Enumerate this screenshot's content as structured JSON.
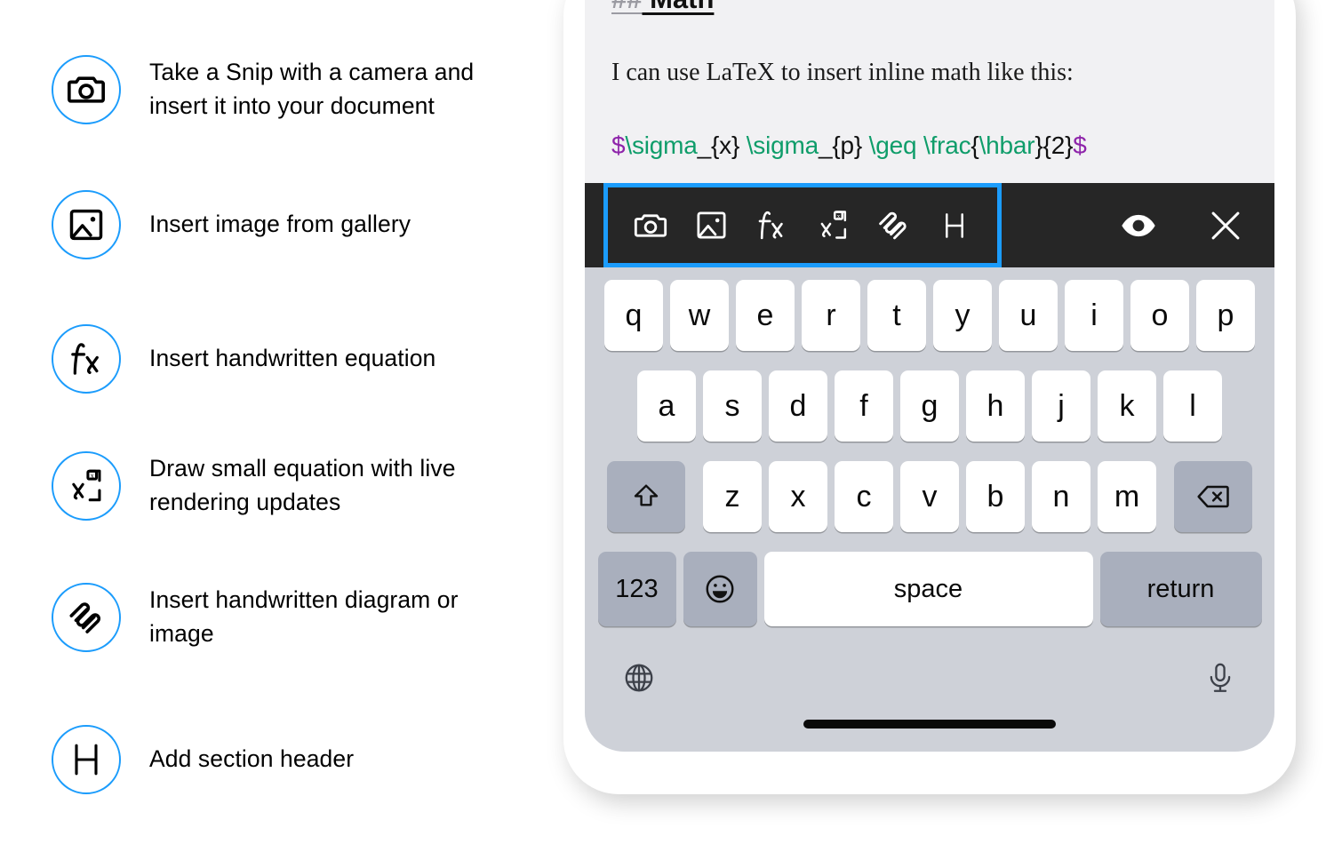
{
  "legend": {
    "items": [
      {
        "icon": "camera-icon",
        "label": "Take a Snip with a camera and insert it into your document"
      },
      {
        "icon": "image-gallery-icon",
        "label": "Insert image from gallery"
      },
      {
        "icon": "fx-function-icon",
        "label": "Insert handwritten equation"
      },
      {
        "icon": "superscript-equation-icon",
        "label": "Draw small equation with live rendering updates"
      },
      {
        "icon": "scribble-diagram-icon",
        "label": "Insert handwritten diagram or image"
      },
      {
        "icon": "header-h-icon",
        "label": "Add section header"
      }
    ]
  },
  "phone": {
    "document": {
      "heading_hashes": "##",
      "heading_title": " Math",
      "paragraph": "I can use LaTeX to insert inline math like this:",
      "latex_tokens": [
        {
          "text": "$",
          "type": "dollar"
        },
        {
          "text": "\\sigma",
          "type": "cmd"
        },
        {
          "text": "_{x} ",
          "type": "plain"
        },
        {
          "text": "\\sigma",
          "type": "cmd"
        },
        {
          "text": "_{p} ",
          "type": "plain"
        },
        {
          "text": "\\geq",
          "type": "cmd"
        },
        {
          "text": " ",
          "type": "plain"
        },
        {
          "text": "\\frac",
          "type": "cmd"
        },
        {
          "text": "{",
          "type": "plain"
        },
        {
          "text": "\\hbar",
          "type": "cmd"
        },
        {
          "text": "}{2}",
          "type": "plain"
        },
        {
          "text": "$",
          "type": "dollar"
        }
      ],
      "latex_raw": "$\\sigma_{x} \\sigma_{p} \\geq \\frac{\\hbar}{2}$"
    },
    "toolbar": {
      "highlight_color": "#1b9cfc",
      "background_color": "#262626",
      "left_buttons": [
        {
          "name": "camera-icon",
          "tooltip": "Take a Snip with a camera"
        },
        {
          "name": "image-gallery-icon",
          "tooltip": "Insert image from gallery"
        },
        {
          "name": "fx-function-icon",
          "tooltip": "Insert handwritten equation"
        },
        {
          "name": "superscript-equation-icon",
          "tooltip": "Draw small equation"
        },
        {
          "name": "scribble-diagram-icon",
          "tooltip": "Insert handwritten diagram"
        },
        {
          "name": "header-h-icon",
          "label": "H",
          "tooltip": "Add section header"
        }
      ],
      "right_buttons": [
        {
          "name": "eye-preview-icon",
          "tooltip": "Preview"
        },
        {
          "name": "close-icon",
          "tooltip": "Close"
        }
      ]
    },
    "keyboard": {
      "row1": [
        "q",
        "w",
        "e",
        "r",
        "t",
        "y",
        "u",
        "i",
        "o",
        "p"
      ],
      "row2": [
        "a",
        "s",
        "d",
        "f",
        "g",
        "h",
        "j",
        "k",
        "l"
      ],
      "row3_letters": [
        "z",
        "x",
        "c",
        "v",
        "b",
        "n",
        "m"
      ],
      "shift_key": "shift-icon",
      "backspace_key": "backspace-icon",
      "numbers_key": "123",
      "emoji_key": "emoji-icon",
      "space_key": "space",
      "return_key": "return",
      "globe_key": "globe-icon",
      "mic_key": "microphone-icon"
    }
  },
  "colors": {
    "accent_blue": "#1b9cfc",
    "toolbar_dark": "#262626",
    "keyboard_bg": "#ced1d8",
    "key_white": "#ffffff",
    "key_gray": "#a9afbd",
    "doc_bg": "#f1f1f3",
    "latex_dollar": "#8e24aa",
    "latex_command": "#0f9d6a",
    "latex_plain": "#111111",
    "heading_hash_gray": "#9b9ba2"
  }
}
